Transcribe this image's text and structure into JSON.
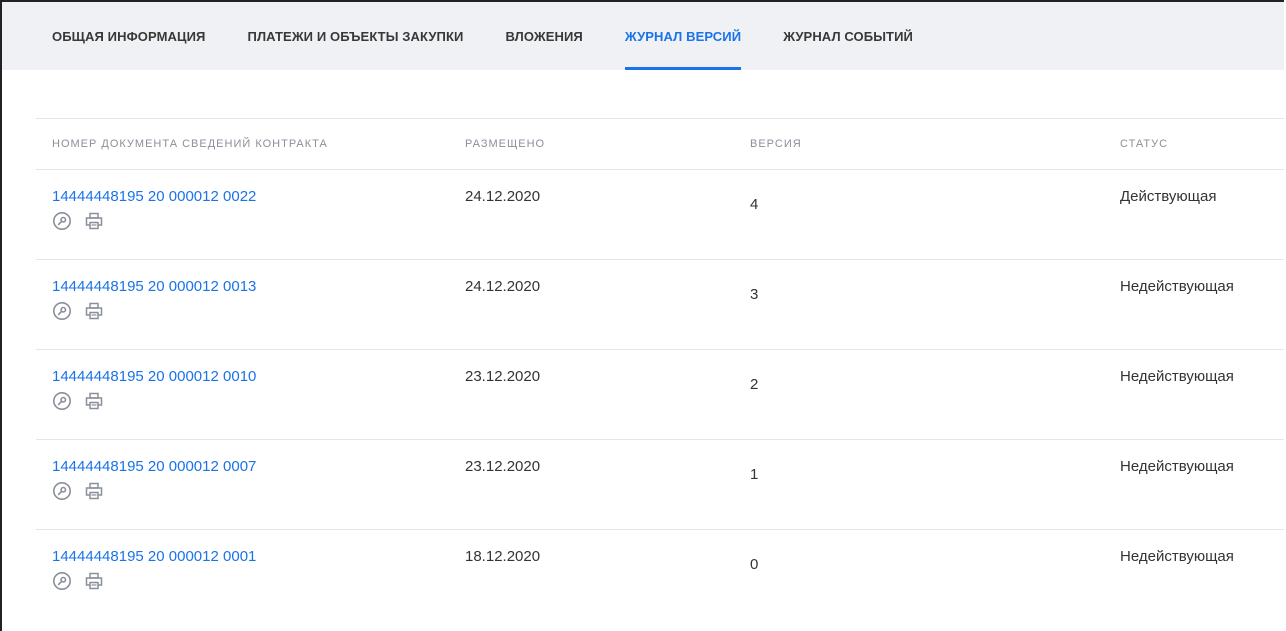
{
  "tabs": [
    {
      "label": "ОБЩАЯ ИНФОРМАЦИЯ"
    },
    {
      "label": "ПЛАТЕЖИ И ОБЪЕКТЫ ЗАКУПКИ"
    },
    {
      "label": "ВЛОЖЕНИЯ"
    },
    {
      "label": "ЖУРНАЛ ВЕРСИЙ",
      "active": true
    },
    {
      "label": "ЖУРНАЛ СОБЫТИЙ"
    }
  ],
  "table": {
    "headers": {
      "doc_number": "НОМЕР ДОКУМЕНТА СВЕДЕНИЙ КОНТРАКТА",
      "placed": "РАЗМЕЩЕНО",
      "version": "ВЕРСИЯ",
      "status": "СТАТУС"
    },
    "rows": [
      {
        "doc_number": "14444448195 20 000012 0022",
        "placed": "24.12.2020",
        "version": "4",
        "status": "Действующая"
      },
      {
        "doc_number": "14444448195 20 000012 0013",
        "placed": "24.12.2020",
        "version": "3",
        "status": "Недействующая"
      },
      {
        "doc_number": "14444448195 20 000012 0010",
        "placed": "23.12.2020",
        "version": "2",
        "status": "Недействующая"
      },
      {
        "doc_number": "14444448195 20 000012 0007",
        "placed": "23.12.2020",
        "version": "1",
        "status": "Недействующая"
      },
      {
        "doc_number": "14444448195 20 000012 0001",
        "placed": "18.12.2020",
        "version": "0",
        "status": "Недействующая"
      }
    ],
    "row_icons": [
      "signature-key-icon",
      "print-icon"
    ]
  },
  "colors": {
    "accent": "#1a73e8",
    "tabbar_bg": "#f0f1f4",
    "header_text": "#8a8f99",
    "icon": "#8a8f99"
  }
}
